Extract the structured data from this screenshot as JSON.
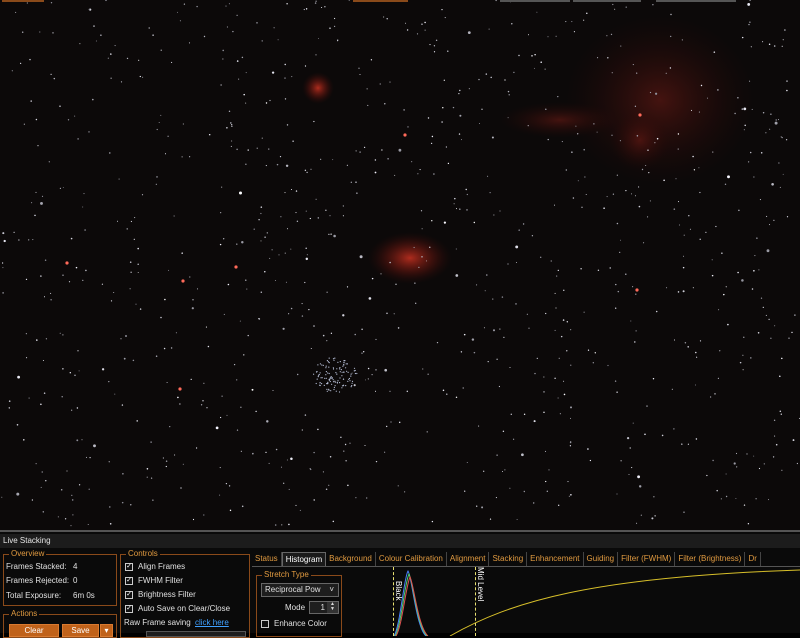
{
  "panel": {
    "title": "Live Stacking",
    "overview": {
      "label": "Overview",
      "frames_stacked_label": "Frames Stacked:",
      "frames_stacked_value": "4",
      "frames_rejected_label": "Frames Rejected:",
      "frames_rejected_value": "0",
      "total_exposure_label": "Total Exposure:",
      "total_exposure_value": "6m 0s"
    },
    "actions": {
      "label": "Actions",
      "clear": "Clear",
      "save": "Save",
      "save_menu": "▾"
    },
    "controls": {
      "label": "Controls",
      "align_frames": "Align Frames",
      "fwhm_filter": "FWHM Filter",
      "brightness_filter": "Brightness Filter",
      "auto_save": "Auto Save on Clear/Close",
      "raw_frame_saving": "Raw Frame saving",
      "click_here": "click here"
    },
    "tabs": [
      "Status",
      "Histogram",
      "Background",
      "Colour Calibration",
      "Alignment",
      "Stacking",
      "Enhancement",
      "Guiding",
      "Filter (FWHM)",
      "Filter (Brightness)",
      "Dr"
    ],
    "histogram": {
      "stretch_type_label": "Stretch Type",
      "stretch_type_value": "Reciprocal Pow",
      "mode_label": "Mode",
      "mode_value": "1",
      "enhance_color": "Enhance Color",
      "black_label": "Black",
      "mid_label": "Mid Level"
    }
  },
  "colors": {
    "accent": "#c0621a",
    "group_label": "#e09a40",
    "link": "#3fa0ff",
    "curve": "#d8c02a"
  }
}
